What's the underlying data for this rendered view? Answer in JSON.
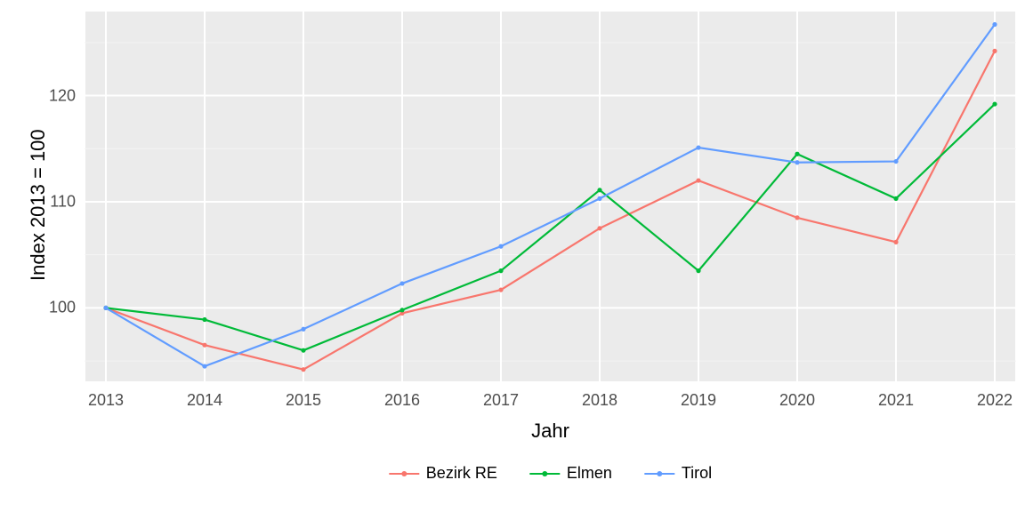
{
  "chart_data": {
    "type": "line",
    "xlabel": "Jahr",
    "ylabel": "Index  2013  = 100",
    "x": [
      2013,
      2014,
      2015,
      2016,
      2017,
      2018,
      2019,
      2020,
      2021,
      2022
    ],
    "x_ticks": [
      "2013",
      "2014",
      "2015",
      "2016",
      "2017",
      "2018",
      "2019",
      "2020",
      "2021",
      "2022"
    ],
    "y_ticks": [
      100,
      110,
      120
    ],
    "ylim": [
      93,
      128
    ],
    "series": [
      {
        "name": "Bezirk RE",
        "color": "#F8766D",
        "values": [
          100.0,
          96.5,
          94.2,
          99.5,
          101.7,
          107.5,
          112.0,
          108.5,
          106.2,
          124.2
        ]
      },
      {
        "name": "Elmen",
        "color": "#00BA38",
        "values": [
          100.0,
          98.9,
          96.0,
          99.8,
          103.5,
          111.1,
          103.5,
          114.5,
          110.3,
          119.2
        ]
      },
      {
        "name": "Tirol",
        "color": "#619CFF",
        "values": [
          100.0,
          94.5,
          98.0,
          102.3,
          105.8,
          110.3,
          115.1,
          113.7,
          113.8,
          126.7
        ]
      }
    ],
    "legend_position": "bottom",
    "grid": true
  },
  "icons": {
    "legend_swatch": "line-with-point"
  }
}
